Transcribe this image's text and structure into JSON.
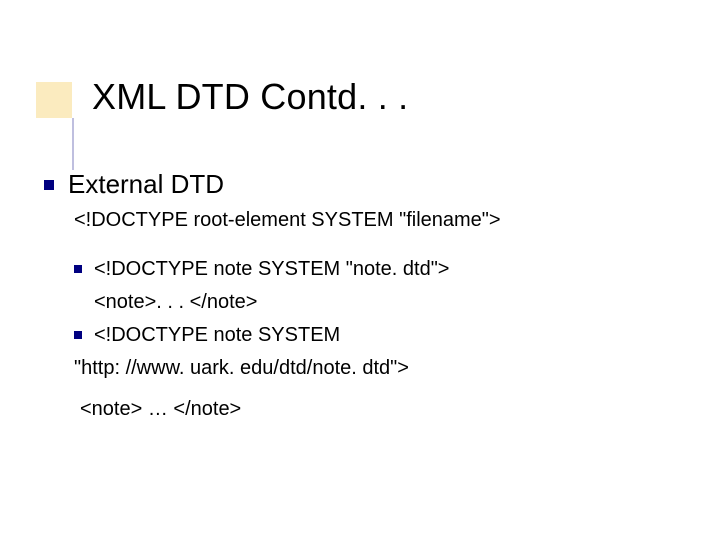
{
  "title": "XML DTD Contd. . .",
  "bullets": {
    "b1": "External DTD",
    "b1_sub1": "<!DOCTYPE root-element SYSTEM \"filename\">",
    "b2": "<!DOCTYPE note SYSTEM \"note. dtd\">",
    "b2_sub1": "<note>. . . </note>",
    "b3": "<!DOCTYPE note SYSTEM",
    "b3_cont": "\"http: //www. uark. edu/dtd/note. dtd\">",
    "b3_sub1": "<note> … </note>"
  }
}
